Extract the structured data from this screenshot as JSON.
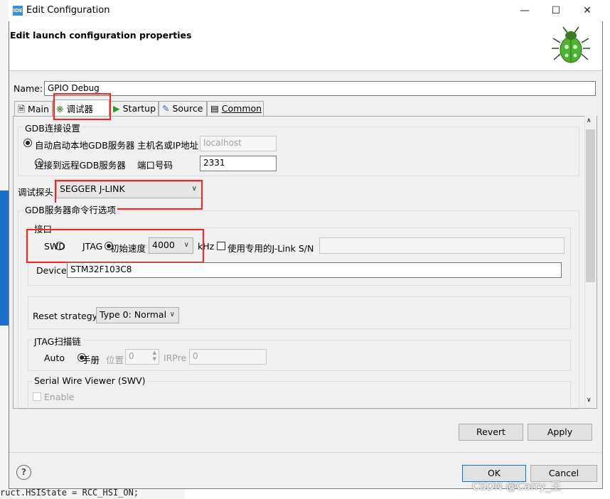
{
  "window": {
    "title": "Edit Configuration",
    "app_icon": "IDE"
  },
  "header": {
    "title": "Edit launch configuration properties",
    "icon": "bug-icon"
  },
  "name_field": {
    "label": "Name:",
    "value": "GPIO Debug"
  },
  "tabs": [
    {
      "label": "Main",
      "icon": "main-tab-icon"
    },
    {
      "label": "调试器",
      "icon": "debugger-tab-icon",
      "active": true
    },
    {
      "label": "Startup",
      "icon": "startup-tab-icon"
    },
    {
      "label": "Source",
      "icon": "source-tab-icon"
    },
    {
      "label": "Common",
      "icon": "common-tab-icon"
    }
  ],
  "gdb": {
    "group_title": "GDB连接设置",
    "local_label": "自动启动本地GDB服务器",
    "host_label": "主机名或IP地址",
    "host_value": "localhost",
    "remote_label": "连接到远程GDB服务器",
    "port_label": "端口号码",
    "port_value": "2331"
  },
  "probe": {
    "label": "调试探头",
    "value": "SEGGER J-LINK"
  },
  "server": {
    "group_title": "GDB服务器命令行选项"
  },
  "interface": {
    "group_title": "接口",
    "swd_label": "SWD",
    "jtag_label": "JTAG",
    "speed_label": "初始速度",
    "speed_value": "4000",
    "khz_label": "kHz",
    "sn_label": "使用专用的J-Link S/N",
    "sn_value": "",
    "device_label": "Device",
    "device_value": "STM32F103C8"
  },
  "reset": {
    "label": "Reset strategy",
    "value": "Type 0: Normal"
  },
  "jtag_chain": {
    "group_title": "JTAG扫描链",
    "auto_label": "Auto",
    "manual_label": "手册",
    "position_label": "位置",
    "position_value": "0",
    "irpre_label": "IRPre",
    "irpre_value": "0"
  },
  "swv": {
    "group_title": "Serial Wire Viewer (SWV)",
    "enable_label": "Enable"
  },
  "buttons": {
    "revert": "Revert",
    "apply": "Apply",
    "ok": "OK",
    "cancel": "Cancel"
  },
  "help_icon": "?",
  "background": {
    "code_line": "ruct.HSIState = RCC_HSI_ON;"
  },
  "watermark": "CSDN @Carry_王",
  "colors": {
    "highlight_box": "#ff2020",
    "default_button_border": "#0078d7"
  }
}
